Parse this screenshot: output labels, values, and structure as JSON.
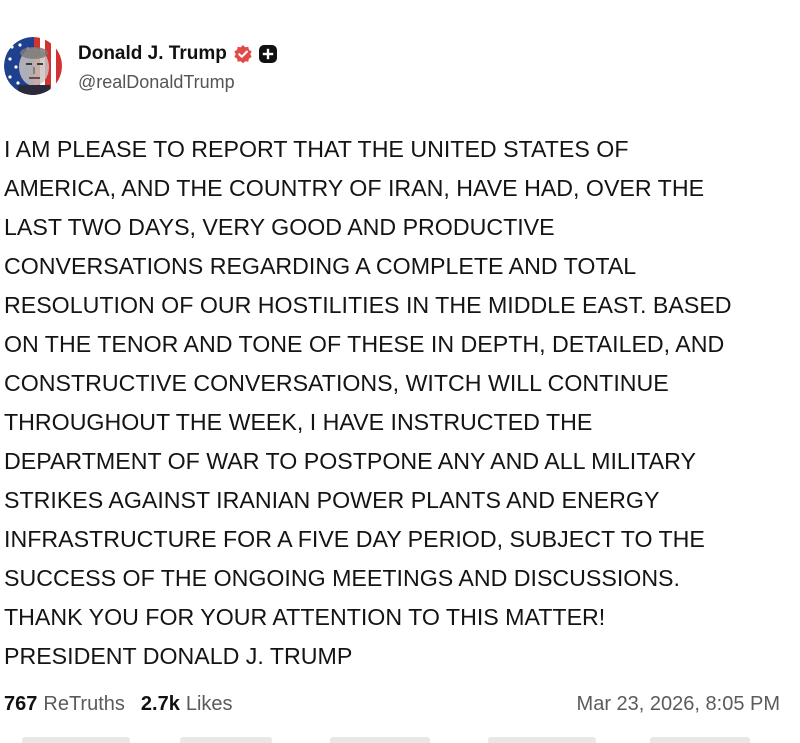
{
  "author": {
    "display_name": "Donald J. Trump",
    "handle": "@realDonaldTrump"
  },
  "post": {
    "lines": [
      "I AM PLEASE TO REPORT THAT THE UNITED STATES OF",
      "AMERICA, AND THE COUNTRY OF IRAN, HAVE HAD, OVER THE",
      "LAST TWO DAYS, VERY GOOD AND PRODUCTIVE",
      "CONVERSATIONS REGARDING A COMPLETE AND TOTAL",
      "RESOLUTION OF OUR HOSTILITIES IN THE MIDDLE EAST. BASED",
      "ON THE TENOR AND TONE OF THESE IN DEPTH, DETAILED, AND",
      "CONSTRUCTIVE CONVERSATIONS, WITCH WILL CONTINUE",
      "THROUGHOUT THE WEEK, I HAVE INSTRUCTED THE",
      "DEPARTMENT OF WAR TO POSTPONE ANY AND ALL MILITARY",
      "STRIKES AGAINST IRANIAN POWER PLANTS AND ENERGY",
      "INFRASTRUCTURE FOR A FIVE DAY PERIOD, SUBJECT TO THE",
      "SUCCESS OF THE ONGOING MEETINGS AND DISCUSSIONS.",
      "THANK YOU FOR YOUR ATTENTION TO THIS MATTER!",
      "PRESIDENT DONALD J. TRUMP"
    ]
  },
  "stats": {
    "retruths_count": "767",
    "retruths_label": "ReTruths",
    "likes_count": "2.7k",
    "likes_label": "Likes",
    "timestamp": "Mar 23, 2026, 8:05 PM"
  },
  "icons": {
    "verified": "verified-badge-icon",
    "plus": "plus-badge-icon"
  },
  "colors": {
    "verified_badge": "#e24a4a",
    "text_primary": "#111111",
    "text_secondary": "#5b5b5b"
  }
}
